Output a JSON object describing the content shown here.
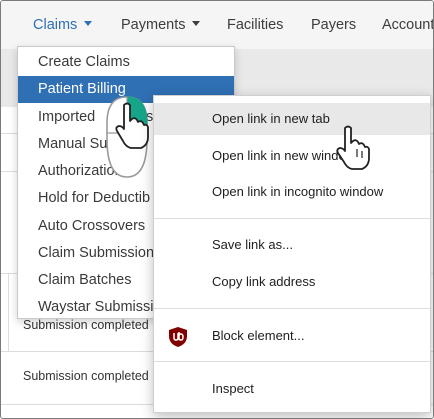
{
  "nav": {
    "items": [
      {
        "label": "Claims",
        "has_caret": true
      },
      {
        "label": "Payments",
        "has_caret": true
      },
      {
        "label": "Facilities"
      },
      {
        "label": "Payers"
      },
      {
        "label": "Account"
      }
    ]
  },
  "dropdown": {
    "items": [
      {
        "label": "Create Claims"
      },
      {
        "label": "Patient Billing"
      },
      {
        "label": "Imported"
      },
      {
        "label": "Manual Su"
      },
      {
        "label": "Authorizations"
      },
      {
        "label": "Hold for Deductib"
      },
      {
        "label": "Auto Crossovers"
      },
      {
        "label": "Claim Submission"
      },
      {
        "label": "Claim Batches"
      },
      {
        "label": "Waystar Submissi"
      }
    ],
    "imported_suffix": "s"
  },
  "rows": {
    "row1": "Submission completed",
    "row2": "Submission completed"
  },
  "context_menu": {
    "items": [
      {
        "label": "Open link in new tab"
      },
      {
        "label": "Open link in new window"
      },
      {
        "label": "Open link in incognito window"
      },
      {
        "label": "Save link as..."
      },
      {
        "label": "Copy link address"
      },
      {
        "label": "Block element..."
      },
      {
        "label": "Inspect"
      }
    ]
  },
  "colors": {
    "accent": "#2f6fb3",
    "ublock_red": "#800000",
    "mouse_teal": "#17a58a"
  },
  "icons": {
    "ublock": "ublock-origin-icon",
    "mouse": "mouse-right-click-icon",
    "cursor": "hand-pointer-icon"
  }
}
